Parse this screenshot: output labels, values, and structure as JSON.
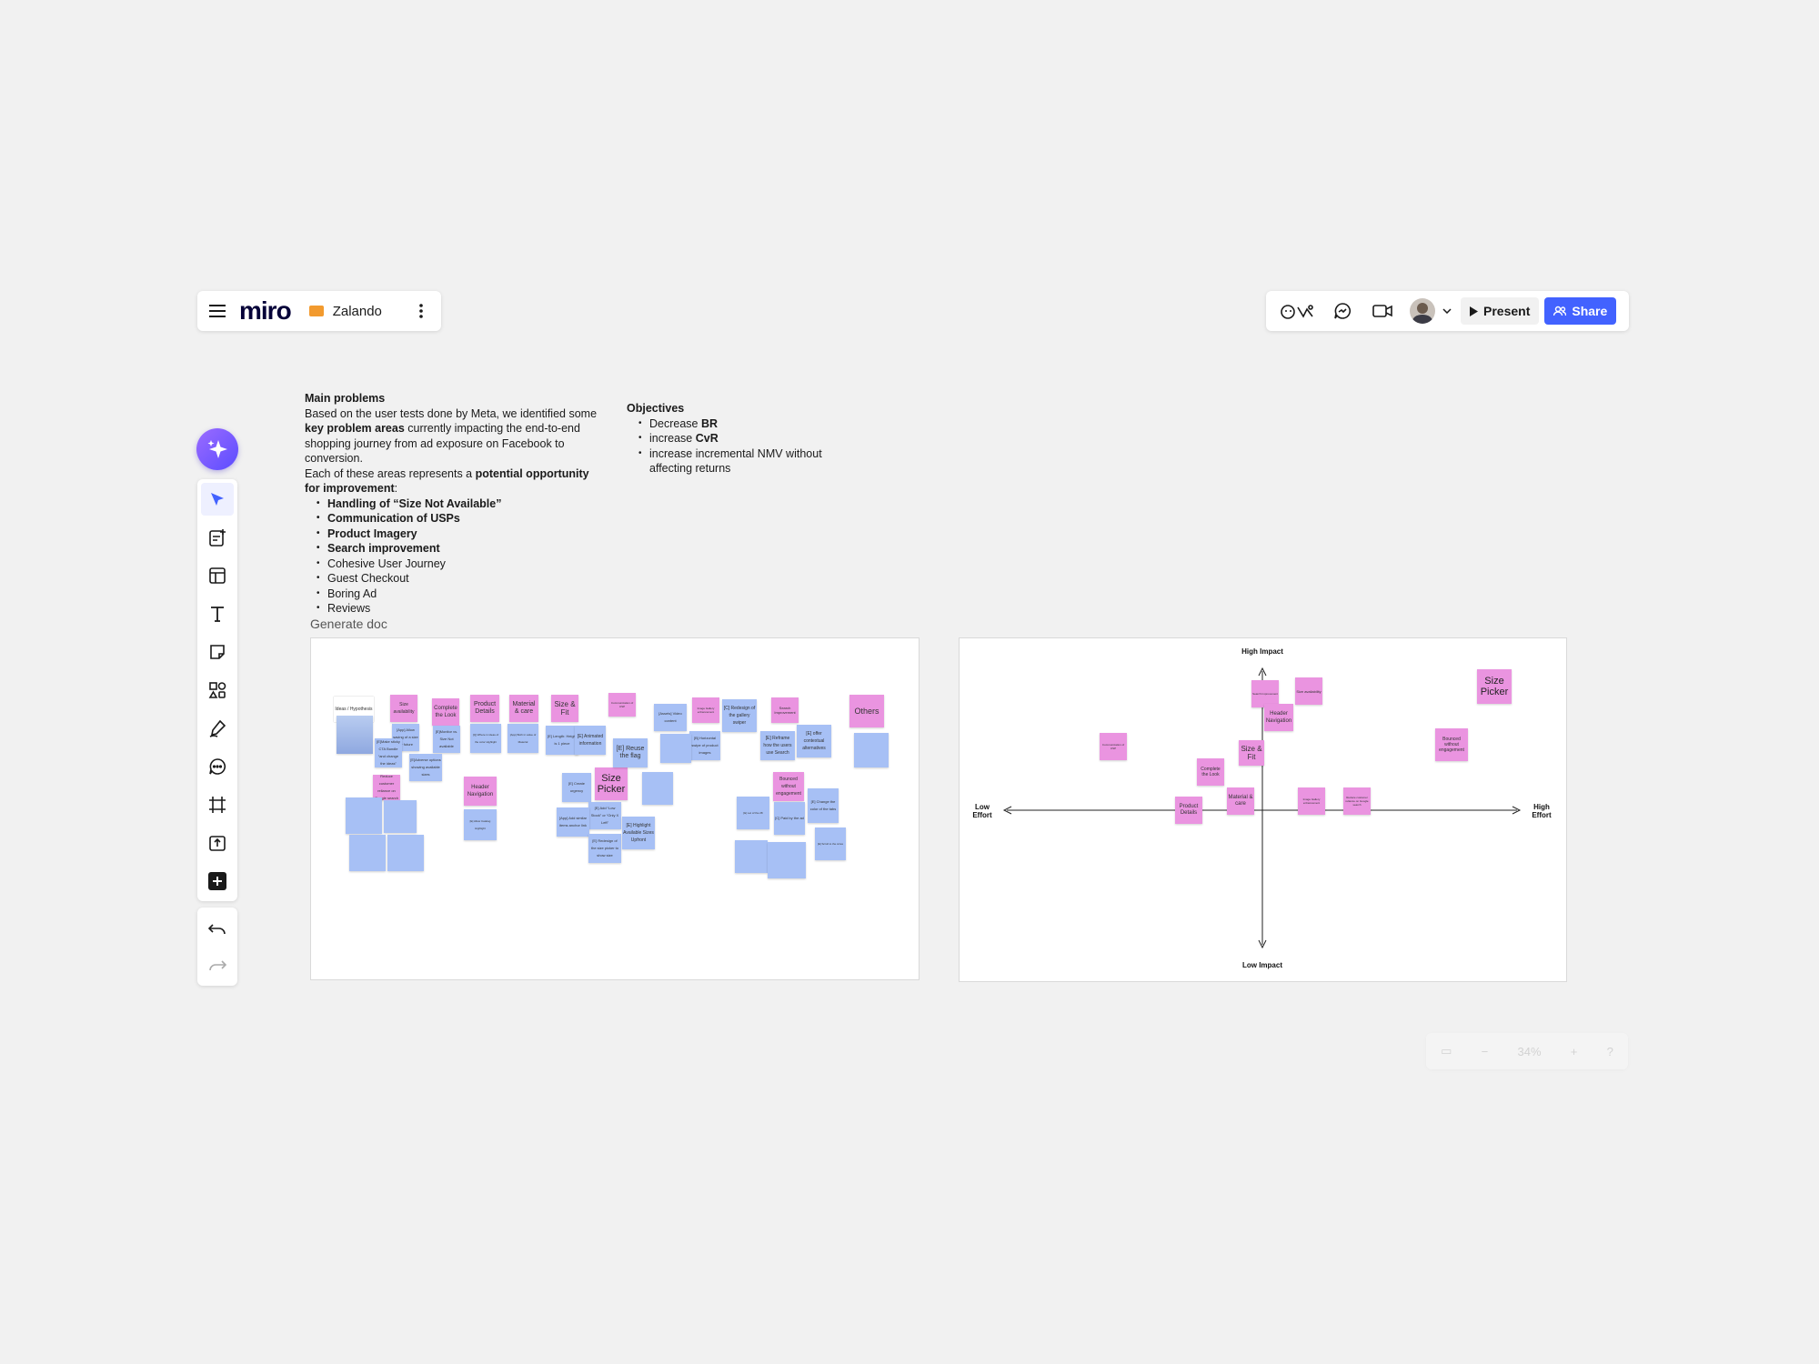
{
  "header": {
    "logo": "miro",
    "board_name": "Zalando"
  },
  "top_actions": {
    "present_label": "Present",
    "share_label": "Share"
  },
  "main_problems": {
    "title": "Main problems",
    "p1_a": "Based on the user tests done by Meta, we identified some ",
    "p1_bold": "key problem areas",
    "p1_b": " currently impacting the end-to-end shopping journey from ad exposure on Facebook to conversion.",
    "p2_a": "Each of these areas represents a ",
    "p2_bold": "potential opportunity for improvement",
    "p2_b": ":",
    "bold_items": [
      "Handling of “Size Not Available”",
      "Communication of USPs",
      "Product Imagery",
      "Search improvement"
    ],
    "items": [
      "Cohesive User Journey",
      "Guest Checkout",
      "Boring Ad",
      "Reviews"
    ]
  },
  "objectives": {
    "title": "Objectives",
    "i1_a": "Decrease ",
    "i1_b": "BR",
    "i2_a": "increase ",
    "i2_b": "CvR",
    "i3": "increase incremental NMV without affecting returns"
  },
  "generate_doc": "Generate doc",
  "frame1": {
    "ideas_label": "Ideas / Hypothesis",
    "categories": [
      "Size availability",
      "Complete the Look",
      "Product Details",
      "Material & care",
      "Size & Fit",
      "Communication of USP",
      "Image Gallery enhancement",
      "Search Improvement",
      "Others"
    ],
    "size_picker": "Size Picker",
    "header_navigation": "Header Navigation",
    "bounced": "Bounced without engagement",
    "reduce": "Reduce customer reliance on Google search",
    "blue_notes": [
      "[App] Allow saving of a size for future",
      "[E]Make sticky CTA Bundle “and change the ideas”",
      "[E]Monitor vs. Size Not available",
      "[E]Adverse options showing available sizes",
      "[Q] Where in ideas of the color Highlight",
      "[App] Both in value of Material",
      "[E] Length: Height is 1 piece",
      "[E] Animated information",
      "[E] Reuse the flag",
      "[Assets] Video content",
      "[C] Redesign of the gallery swiper",
      "[E] Reframe how the users use Search",
      "[E] offer contextual alternatives",
      "[B] Horizontal swipe of product images",
      "[E] Create urgency",
      "[E] Add “Low Stock” or “Only X Left”",
      "[App] Add similar items anchor link",
      "[E] Redesign of the size picker to show size",
      "[E] Highlight Available Sizes Upfront",
      "[E] Change the color of the tabs",
      "[E] Let of the 28",
      "[C] Paid by the ad",
      "[E] Allow Catalog Highlight",
      "[E] Scroll to the sizes"
    ]
  },
  "frame2": {
    "axis_top": "High Impact",
    "axis_bottom": "Low Impact",
    "axis_left": "Low Effort",
    "axis_right": "High Effort",
    "notes": [
      "Communication of USP",
      "Search Improvement",
      "Size availability",
      "Header Navigation",
      "Size & Fit",
      "Complete the Look",
      "Product Details",
      "Material & care",
      "Image Gallery enhancement",
      "Reduce customer reliance on Google search",
      "Bounced without engagement",
      "Size Picker"
    ]
  },
  "zoom": {
    "level": "34%"
  }
}
